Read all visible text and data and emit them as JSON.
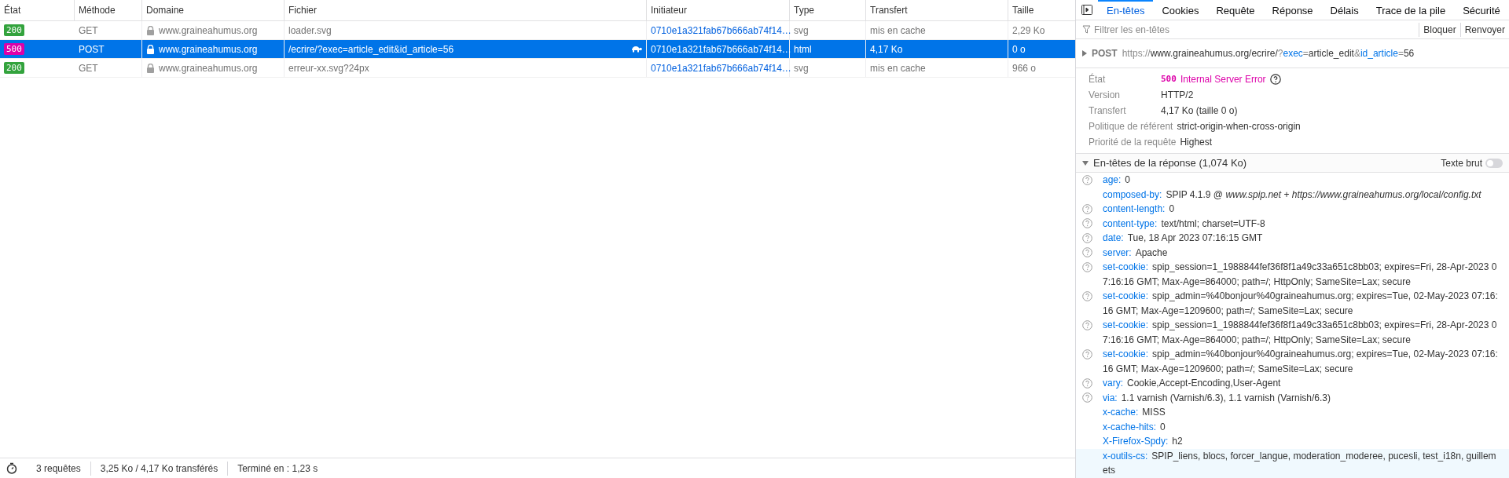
{
  "requests_table": {
    "columns": [
      "État",
      "Méthode",
      "Domaine",
      "Fichier",
      "Initiateur",
      "Type",
      "Transfert",
      "Taille"
    ],
    "rows": [
      {
        "status": "200",
        "color": "#33a33d",
        "method": "GET",
        "domain": "www.graineahumus.org",
        "file": "loader.svg",
        "slow": false,
        "initiator": "0710e1a321fab67b666ab74f14…",
        "type": "svg",
        "transfer": "mis en cache",
        "size": "2,29 Ko",
        "selected": false
      },
      {
        "status": "500",
        "color": "#dd00a9",
        "method": "POST",
        "domain": "www.graineahumus.org",
        "file": "/ecrire/?exec=article_edit&id_article=56",
        "slow": true,
        "initiator": "0710e1a321fab67b666ab74f14…",
        "type": "html",
        "transfer": "4,17 Ko",
        "size": "0 o",
        "selected": true
      },
      {
        "status": "200",
        "color": "#33a33d",
        "method": "GET",
        "domain": "www.graineahumus.org",
        "file": "erreur-xx.svg?24px",
        "slow": false,
        "initiator": "0710e1a321fab67b666ab74f14…",
        "type": "svg",
        "transfer": "mis en cache",
        "size": "966 o",
        "selected": false
      }
    ]
  },
  "status_bar": [
    "3 requêtes",
    "3,25 Ko / 4,17 Ko transférés",
    "Terminé en : 1,23 s"
  ],
  "details": {
    "tabs": [
      {
        "label": "En-têtes",
        "selected": true
      },
      {
        "label": "Cookies",
        "selected": false
      },
      {
        "label": "Requête",
        "selected": false
      },
      {
        "label": "Réponse",
        "selected": false
      },
      {
        "label": "Délais",
        "selected": false
      },
      {
        "label": "Trace de la pile",
        "selected": false
      },
      {
        "label": "Sécurité",
        "selected": false
      }
    ],
    "filter": {
      "placeholder": "Filtrer les en-têtes"
    },
    "buttons": [
      "Bloquer",
      "Renvoyer"
    ],
    "request_line": {
      "method": "POST",
      "url_parts": [
        {
          "kind": "punct",
          "text": "https://"
        },
        {
          "kind": "value",
          "text": "www.graineahumus.org/ecrire/"
        },
        {
          "kind": "punct",
          "text": "?"
        },
        {
          "kind": "key",
          "text": "exec"
        },
        {
          "kind": "punct",
          "text": "="
        },
        {
          "kind": "value",
          "text": "article_edit"
        },
        {
          "kind": "punct",
          "text": "&"
        },
        {
          "kind": "key",
          "text": "id_article"
        },
        {
          "kind": "punct",
          "text": "="
        },
        {
          "kind": "value",
          "text": "56"
        }
      ]
    },
    "summary": [
      {
        "kind": "status",
        "label": "État",
        "code": "500",
        "value": "Internal Server Error"
      },
      {
        "kind": "text",
        "label": "Version",
        "value": "HTTP/2"
      },
      {
        "kind": "text",
        "label": "Transfert",
        "value": "4,17 Ko (taille 0 o)"
      },
      {
        "kind": "text",
        "label": "Politique de référent",
        "value": "strict-origin-when-cross-origin"
      },
      {
        "kind": "text",
        "label": "Priorité de la requête",
        "value": "Highest"
      }
    ],
    "response_headers": {
      "title": "En-têtes de la réponse (1,074 Ko)",
      "expanded": true,
      "raw_toggle": {
        "label": "Texte brut",
        "on": false
      },
      "headers": [
        {
          "name": "age:",
          "value": "0",
          "help": true,
          "highlighted": false
        },
        {
          "name": "composed-by:",
          "value": "SPIP 4.1.9 @ *www.spip.net* + *https://www.graineahumus.org/local/config.txt*",
          "help": false,
          "highlighted": false
        },
        {
          "name": "content-length:",
          "value": "0",
          "help": true,
          "highlighted": false
        },
        {
          "name": "content-type:",
          "value": "text/html; charset=UTF-8",
          "help": true,
          "highlighted": false
        },
        {
          "name": "date:",
          "value": "Tue, 18 Apr 2023 07:16:15 GMT",
          "help": true,
          "highlighted": false
        },
        {
          "name": "server:",
          "value": "Apache",
          "help": true,
          "highlighted": false
        },
        {
          "name": "set-cookie:",
          "value": "spip_session=1_1988844fef36f8f1a49c33a651c8bb03; expires=Fri, 28-Apr-2023 07:16:16 GMT; Max-Age=864000; path=/; HttpOnly; SameSite=Lax; secure",
          "help": true,
          "highlighted": false
        },
        {
          "name": "set-cookie:",
          "value": "spip_admin=%40bonjour%40graineahumus.org; expires=Tue, 02-May-2023 07:16:16 GMT; Max-Age=1209600; path=/; SameSite=Lax; secure",
          "help": true,
          "highlighted": false
        },
        {
          "name": "set-cookie:",
          "value": "spip_session=1_1988844fef36f8f1a49c33a651c8bb03; expires=Fri, 28-Apr-2023 07:16:16 GMT; Max-Age=864000; path=/; HttpOnly; SameSite=Lax; secure",
          "help": true,
          "highlighted": false
        },
        {
          "name": "set-cookie:",
          "value": "spip_admin=%40bonjour%40graineahumus.org; expires=Tue, 02-May-2023 07:16:16 GMT; Max-Age=1209600; path=/; SameSite=Lax; secure",
          "help": true,
          "highlighted": false
        },
        {
          "name": "vary:",
          "value": "Cookie,Accept-Encoding,User-Agent",
          "help": true,
          "highlighted": false
        },
        {
          "name": "via:",
          "value": "1.1 varnish (Varnish/6.3), 1.1 varnish (Varnish/6.3)",
          "help": true,
          "highlighted": false
        },
        {
          "name": "x-cache:",
          "value": "MISS",
          "help": false,
          "highlighted": false
        },
        {
          "name": "x-cache-hits:",
          "value": "0",
          "help": false,
          "highlighted": false
        },
        {
          "name": "X-Firefox-Spdy:",
          "value": "h2",
          "help": false,
          "highlighted": false
        },
        {
          "name": "x-outils-cs:",
          "value": "SPIP_liens, blocs, forcer_langue, moderation_moderee, pucesli, test_i18n, guillemets",
          "help": false,
          "highlighted": true
        }
      ]
    }
  }
}
